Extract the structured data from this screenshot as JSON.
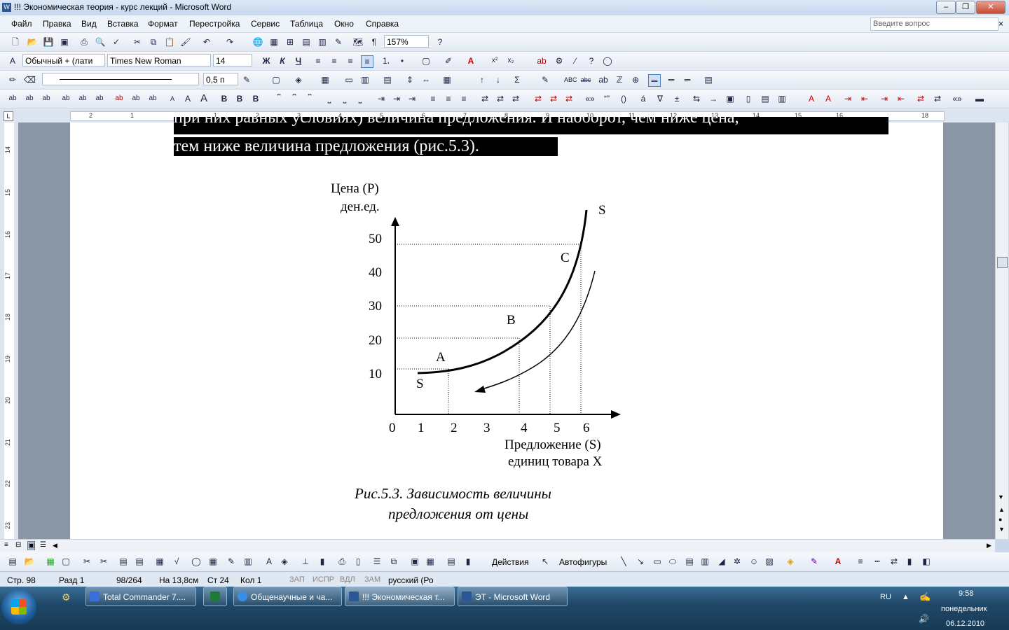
{
  "window": {
    "title": "!!! Экономическая теория - курс лекций - Microsoft Word",
    "ask_placeholder": "Введите вопрос"
  },
  "menu": [
    "Файл",
    "Правка",
    "Вид",
    "Вставка",
    "Формат",
    "Перестройка",
    "Сервис",
    "Таблица",
    "Окно",
    "Справка"
  ],
  "toolbar": {
    "zoom": "157%",
    "style": "Обычный + (лати",
    "font": "Times New Roman",
    "size": "14",
    "line_width": "0,5 п"
  },
  "document": {
    "line1": "при них равных условиях) величина предложения. И наоборот, чем ниже цена,",
    "line2": "тем ниже величина предложения (рис.5.3).",
    "caption1": "Рис.5.3. Зависимость величины",
    "caption2": "предложения от цены"
  },
  "chart_data": {
    "type": "line",
    "ylabel_line1": "Цена (Р)",
    "ylabel_line2": "ден.ед.",
    "xlabel_line1": "Предложение (S)",
    "xlabel_line2": "единиц товара Х",
    "x_ticks": [
      "0",
      "1",
      "2",
      "3",
      "4",
      "5",
      "6"
    ],
    "y_ticks": [
      "10",
      "20",
      "30",
      "40",
      "50"
    ],
    "curve_label_top": "S",
    "curve_label_bottom": "S",
    "points": [
      {
        "label": "A",
        "x": 2,
        "y": 10
      },
      {
        "label": "B",
        "x": 4,
        "y": 20
      },
      {
        "label": "C",
        "x": 6,
        "y": 50
      }
    ],
    "reference_points": [
      {
        "x": 4,
        "y": 20
      },
      {
        "x": 5,
        "y": 30
      },
      {
        "x": 6,
        "y": 50
      }
    ]
  },
  "drawbar": {
    "actions": "Действия",
    "autoshapes": "Автофигуры"
  },
  "status": {
    "page": "Стр. 98",
    "section": "Разд 1",
    "pages": "98/264",
    "at": "На 13,8см",
    "line": "Ст 24",
    "col": "Кол 1",
    "rec": "ЗАП",
    "trk": "ИСПР",
    "ext": "ВДЛ",
    "ovr": "ЗАМ",
    "lang": "русский (Ро"
  },
  "taskbar": {
    "tasks": [
      "Total Commander 7....",
      "Общенаучные и ча...",
      "!!! Экономическая т...",
      "ЭТ - Microsoft Word"
    ],
    "lang": "RU",
    "time": "9:58",
    "day": "понедельник",
    "date": "06.12.2010"
  },
  "ruler_h": [
    "2",
    "1",
    "1",
    "2",
    "3",
    "4",
    "5",
    "6",
    "7",
    "8",
    "9",
    "10",
    "11",
    "12",
    "13",
    "14",
    "15",
    "16",
    "17",
    "18"
  ],
  "ruler_v": [
    "14",
    "15",
    "16",
    "17",
    "18",
    "19",
    "20",
    "21",
    "22",
    "23"
  ]
}
